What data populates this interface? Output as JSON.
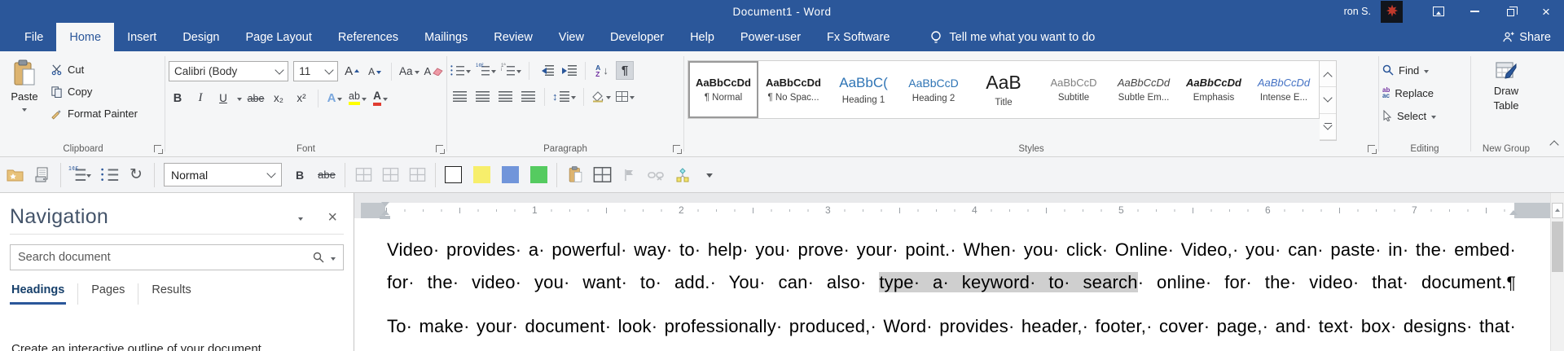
{
  "titlebar": {
    "title": "Document1  -  Word",
    "user": "ron S."
  },
  "tabs": {
    "items": [
      {
        "label": "File",
        "active": false
      },
      {
        "label": "Home",
        "active": true
      },
      {
        "label": "Insert",
        "active": false
      },
      {
        "label": "Design",
        "active": false
      },
      {
        "label": "Page Layout",
        "active": false
      },
      {
        "label": "References",
        "active": false
      },
      {
        "label": "Mailings",
        "active": false
      },
      {
        "label": "Review",
        "active": false
      },
      {
        "label": "View",
        "active": false
      },
      {
        "label": "Developer",
        "active": false
      },
      {
        "label": "Help",
        "active": false
      },
      {
        "label": "Power-user",
        "active": false
      },
      {
        "label": "Fx Software",
        "active": false
      }
    ],
    "tell_me": "Tell me what you want to do",
    "share": "Share"
  },
  "ribbon": {
    "clipboard": {
      "label": "Clipboard",
      "paste": "Paste",
      "cut": "Cut",
      "copy": "Copy",
      "format_painter": "Format Painter"
    },
    "font": {
      "label": "Font",
      "name": "Calibri (Body",
      "size": "11",
      "grow": "A",
      "shrink": "A",
      "change_case": "Aa",
      "bold": "B",
      "italic": "I",
      "underline": "U",
      "strikethrough": "abe",
      "subscript": "x₂",
      "superscript": "x²",
      "effects": "A",
      "highlight": "ab",
      "color": "A",
      "clear": "A"
    },
    "paragraph": {
      "label": "Paragraph",
      "sort_a": "A",
      "sort_z": "Z",
      "updown": "↕",
      "pilcrow": "¶"
    },
    "styles": {
      "label": "Styles",
      "items": [
        {
          "sample": "AaBbCcDd",
          "name": "¶ Normal",
          "kind": "normal",
          "selected": true
        },
        {
          "sample": "AaBbCcDd",
          "name": "¶ No Spac...",
          "kind": "nospacing",
          "selected": false
        },
        {
          "sample": "AaBbC(",
          "name": "Heading 1",
          "kind": "heading1",
          "selected": false
        },
        {
          "sample": "AaBbCcD",
          "name": "Heading 2",
          "kind": "heading2",
          "selected": false
        },
        {
          "sample": "AaB",
          "name": "Title",
          "kind": "title",
          "selected": false
        },
        {
          "sample": "AaBbCcD",
          "name": "Subtitle",
          "kind": "subtitle",
          "selected": false
        },
        {
          "sample": "AaBbCcDd",
          "name": "Subtle Em...",
          "kind": "subtle",
          "selected": false
        },
        {
          "sample": "AaBbCcDd",
          "name": "Emphasis",
          "kind": "emphasis",
          "selected": false
        },
        {
          "sample": "AaBbCcDd",
          "name": "Intense E...",
          "kind": "intense",
          "selected": false
        }
      ]
    },
    "editing": {
      "label": "Editing",
      "find": "Find",
      "replace": "Replace",
      "select": "Select",
      "replace_icon_top": "ab",
      "replace_icon_bottom": "ac"
    },
    "new_group": {
      "label": "New Group",
      "draw_line1": "Draw",
      "draw_line2": "Table"
    }
  },
  "toolbar": {
    "style_box": "Normal",
    "bold": "B",
    "strikethrough": "abe",
    "refresh_glyph": "↻",
    "swatches": [
      {
        "name": "white-swatch",
        "color": "#ffffff"
      },
      {
        "name": "yellow-swatch",
        "color": "#f7ee6b"
      },
      {
        "name": "blue-swatch",
        "color": "#7195da"
      },
      {
        "name": "green-swatch",
        "color": "#55cb60"
      }
    ]
  },
  "navigation": {
    "title": "Navigation",
    "search_placeholder": "Search document",
    "tabs": [
      {
        "label": "Headings",
        "active": true
      },
      {
        "label": "Pages",
        "active": false
      },
      {
        "label": "Results",
        "active": false
      }
    ],
    "hint": "Create an interactive outline of your document."
  },
  "document": {
    "ruler_numbers": [
      "1",
      "2",
      "3",
      "4",
      "5",
      "6",
      "7"
    ],
    "paragraphs": [
      {
        "lines": [
          {
            "segs": [
              {
                "t": "Video· provides· a· powerful· way· to· help· you· prove· your· point.· When· you· click· Online· Video,· you· can· paste· in· the· embed· code·",
                "hl": false
              }
            ]
          },
          {
            "segs": [
              {
                "t": "for· the· video· you· want· to· add.· You· can· also· ",
                "hl": false
              },
              {
                "t": "type· a· keyword· to· search",
                "hl": true
              },
              {
                "t": "· online· for· the· video· that· document.",
                "hl": false
              },
              {
                "t": "¶",
                "hl": false,
                "mark": true
              }
            ]
          }
        ]
      },
      {
        "lines": [
          {
            "segs": [
              {
                "t": "To· make· your· document· look· professionally· produced,· Word· provides· header,· footer,· cover· page,· and· text· box· designs· that·",
                "hl": false
              }
            ]
          }
        ]
      }
    ]
  },
  "colors": {
    "titlebar_blue": "#2b579a",
    "heading_blue": "#2e74b5",
    "intense_blue": "#4472c4",
    "selection_gray": "#cfcfcf",
    "highlight_yellow": "#ffff00",
    "font_color_red": "#e03c31"
  }
}
